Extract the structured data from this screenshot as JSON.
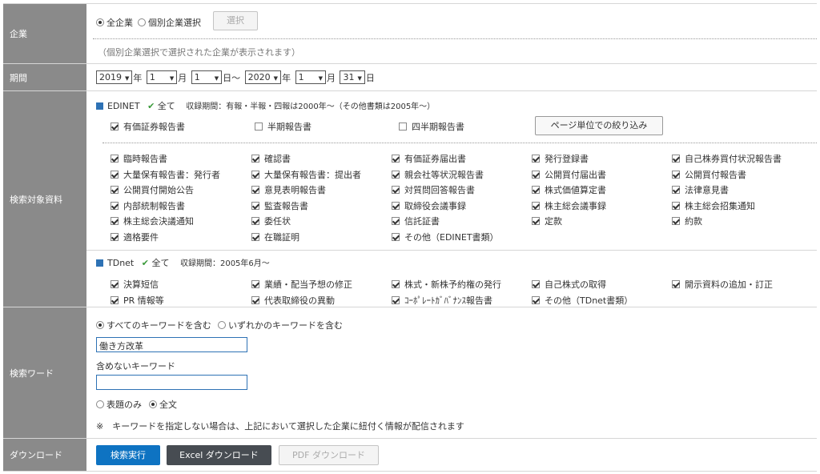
{
  "company": {
    "label": "企業",
    "radio_all": "全企業",
    "radio_individual": "個別企業選択",
    "select_button": "選択",
    "hint": "（個別企業選択で選択された企業が表示されます）"
  },
  "period": {
    "label": "期間",
    "from_year": "2019",
    "from_month": "1",
    "from_day": "1",
    "to_year": "2020",
    "to_month": "1",
    "to_day": "31",
    "year_unit": "年",
    "month_unit": "月",
    "day_unit": "日",
    "range_sep": "日～"
  },
  "documents": {
    "label": "検索対象資料",
    "edinet": {
      "name": "EDINET",
      "all_label": "全て",
      "coverage": "収録期間：有報・半報・四報は2000年～（その他書類は2005年～）",
      "top_items": [
        "有価証券報告書",
        "半期報告書",
        "四半期報告書"
      ],
      "page_filter_button": "ページ単位での絞り込み",
      "items": [
        "臨時報告書",
        "確認書",
        "有価証券届出書",
        "発行登録書",
        "自己株券買付状況報告書",
        "大量保有報告書：発行者",
        "大量保有報告書：提出者",
        "親会社等状況報告書",
        "公開買付届出書",
        "公開買付報告書",
        "公開買付開始公告",
        "意見表明報告書",
        "対質問回答報告書",
        "株式価値算定書",
        "法律意見書",
        "内部統制報告書",
        "監査報告書",
        "取締役会議事録",
        "株主総会議事録",
        "株主総会招集通知",
        "株主総会決議通知",
        "委任状",
        "信託証書",
        "定款",
        "約款",
        "適格要件",
        "在職証明",
        "その他（EDINET書類）"
      ]
    },
    "tdnet": {
      "name": "TDnet",
      "all_label": "全て",
      "coverage": "収録期間：2005年6月～",
      "items": [
        "決算短信",
        "業績・配当予想の修正",
        "株式・新株予約権の発行",
        "自己株式の取得",
        "開示資料の追加・訂正",
        "PR 情報等",
        "代表取締役の異動",
        "ｺｰﾎﾟﾚｰﾄｶﾞﾊﾞﾅﾝｽ報告書",
        "その他（TDnet書類）"
      ]
    }
  },
  "keyword": {
    "label": "検索ワード",
    "radio_all": "すべてのキーワードを含む",
    "radio_any": "いずれかのキーワードを含む",
    "keyword_value": "働き方改革",
    "exclude_label": "含めないキーワード",
    "exclude_value": "",
    "scope_title": "表題のみ",
    "scope_full": "全文",
    "note": "※　キーワードを指定しない場合は、上記において選択した企業に紐付く情報が配信されます"
  },
  "download": {
    "label": "ダウンロード",
    "search_button": "検索実行",
    "excel_button": "Excel ダウンロード",
    "pdf_button": "PDF ダウンロード"
  }
}
